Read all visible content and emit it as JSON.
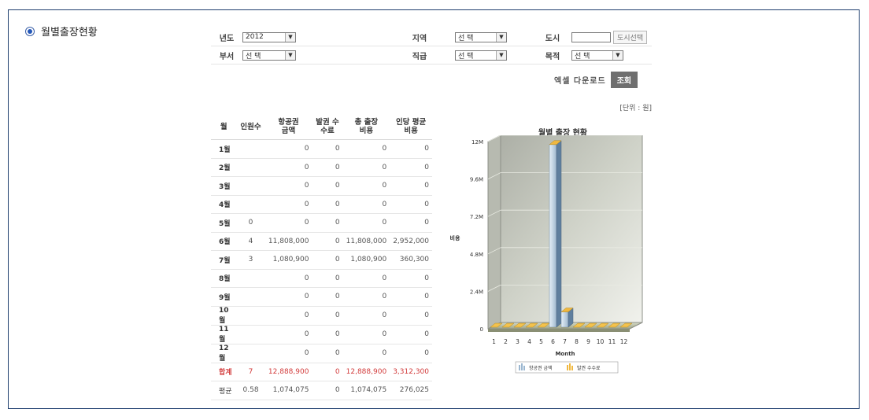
{
  "section": {
    "title": "월별출장현황"
  },
  "filters": {
    "year_label": "년도",
    "year_value": "2012",
    "region_label": "지역",
    "region_value": "선 택",
    "city_label": "도시",
    "city_value": "",
    "city_button": "도시선택",
    "dept_label": "부서",
    "dept_value": "선 택",
    "position_label": "직급",
    "position_value": "선 택",
    "purpose_label": "목적",
    "purpose_value": "선 택"
  },
  "actions": {
    "excel": "엑셀 다운로드",
    "query": "조회"
  },
  "unit": "[단위 : 원]",
  "table": {
    "headers": [
      "월",
      "인원수",
      "항공권 금액",
      "발권 수수료",
      "총 출장 비용",
      "인당 평균비용"
    ],
    "rows": [
      [
        "1월",
        "",
        "0",
        "0",
        "0",
        "0"
      ],
      [
        "2월",
        "",
        "0",
        "0",
        "0",
        "0"
      ],
      [
        "3월",
        "",
        "0",
        "0",
        "0",
        "0"
      ],
      [
        "4월",
        "",
        "0",
        "0",
        "0",
        "0"
      ],
      [
        "5월",
        "0",
        "0",
        "0",
        "0",
        "0"
      ],
      [
        "6월",
        "4",
        "11,808,000",
        "0",
        "11,808,000",
        "2,952,000"
      ],
      [
        "7월",
        "3",
        "1,080,900",
        "0",
        "1,080,900",
        "360,300"
      ],
      [
        "8월",
        "",
        "0",
        "0",
        "0",
        "0"
      ],
      [
        "9월",
        "",
        "0",
        "0",
        "0",
        "0"
      ],
      [
        "10월",
        "",
        "0",
        "0",
        "0",
        "0"
      ],
      [
        "11월",
        "",
        "0",
        "0",
        "0",
        "0"
      ],
      [
        "12월",
        "",
        "0",
        "0",
        "0",
        "0"
      ]
    ],
    "total": [
      "합계",
      "7",
      "12,888,900",
      "0",
      "12,888,900",
      "3,312,300"
    ],
    "average": [
      "평균",
      "0.58",
      "1,074,075",
      "0",
      "1,074,075",
      "276,025"
    ]
  },
  "chart_data": {
    "type": "bar",
    "title": "월별 출장 현황",
    "xlabel": "Month",
    "ylabel": "비용",
    "categories": [
      "1",
      "2",
      "3",
      "4",
      "5",
      "6",
      "7",
      "8",
      "9",
      "10",
      "11",
      "12"
    ],
    "ylim": [
      0,
      12000000
    ],
    "yticks": [
      "0",
      "2.4M",
      "4.8M",
      "7.2M",
      "9.6M",
      "12M"
    ],
    "series": [
      {
        "name": "항공권 금액",
        "color": "#9bb7d0",
        "values": [
          0,
          0,
          0,
          0,
          0,
          11808000,
          1080900,
          0,
          0,
          0,
          0,
          0
        ]
      },
      {
        "name": "발권 수수료",
        "color": "#f0b840",
        "values": [
          0,
          0,
          0,
          0,
          0,
          0,
          0,
          0,
          0,
          0,
          0,
          0
        ]
      }
    ],
    "legend": "bottom",
    "grid": true
  }
}
